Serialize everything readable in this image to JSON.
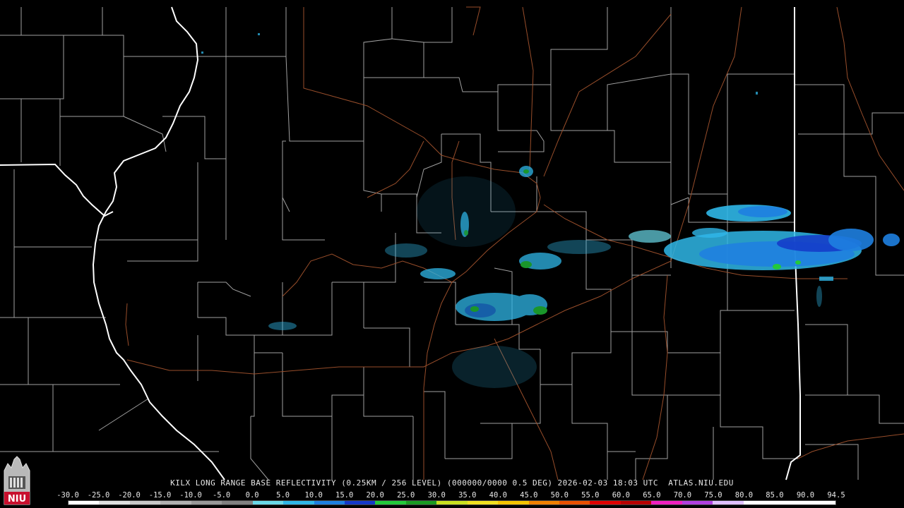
{
  "product": {
    "title": "KILX LONG RANGE BASE REFLECTIVITY (0.25KM / 256 LEVEL) (000000/0000 0.5 DEG) 2026-02-03 18:03 UTC  ATLAS.NIU.EDU"
  },
  "logo": {
    "text": "NIU",
    "bg_color": "#c8102e"
  },
  "colors": {
    "background": "#000000",
    "county_lines": "#bdbdbd",
    "state_lines": "#ffffff",
    "highways": "#a0522d"
  },
  "scale": {
    "labels": [
      "-30.0",
      "-25.0",
      "-20.0",
      "-15.0",
      "-10.0",
      "-5.0",
      "0.0",
      "5.0",
      "10.0",
      "15.0",
      "20.0",
      "25.0",
      "30.0",
      "35.0",
      "40.0",
      "45.0",
      "50.0",
      "55.0",
      "60.0",
      "65.0",
      "70.0",
      "75.0",
      "80.0",
      "85.0",
      "90.0",
      "94.5"
    ],
    "colors": [
      "#ffffff",
      "#e0e0e0",
      "#c8c8c8",
      "#b0b0b0",
      "#989898",
      "#808080",
      "#6ad8e8",
      "#2fb7e8",
      "#1e7fe0",
      "#1438c8",
      "#23c93a",
      "#1a9a22",
      "#c9e020",
      "#f0e020",
      "#f5c400",
      "#f08000",
      "#e85000",
      "#e00000",
      "#b80000",
      "#f020c0",
      "#b040e0",
      "#e0c0ff",
      "#ffffff",
      "#ffffff",
      "#ffffff"
    ]
  }
}
